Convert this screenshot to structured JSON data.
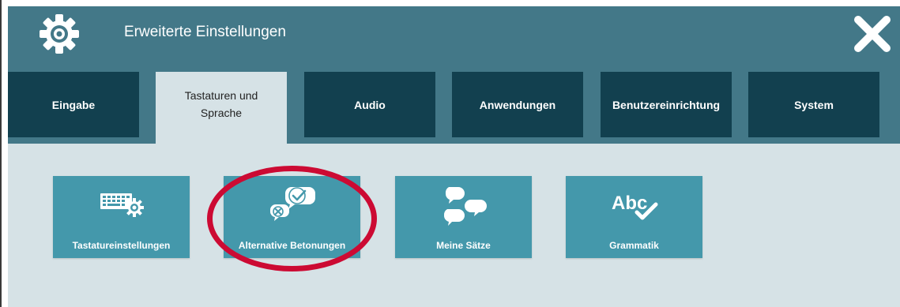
{
  "header": {
    "title": "Erweiterte Einstellungen",
    "settings_icon": "gear-icon",
    "close_icon": "close-icon"
  },
  "tabs": [
    {
      "label": "Eingabe",
      "active": false
    },
    {
      "label": "Tastaturen und Sprache",
      "active": true
    },
    {
      "label": "Audio",
      "active": false
    },
    {
      "label": "Anwendungen",
      "active": false
    },
    {
      "label": "Benutzereinrichtung",
      "active": false
    },
    {
      "label": "System",
      "active": false
    }
  ],
  "tiles": [
    {
      "label": "Tastatureinstellungen",
      "icon": "keyboard-gear-icon"
    },
    {
      "label": "Alternative Betonungen",
      "icon": "speech-bubbles-check-cross-icon"
    },
    {
      "label": "Meine Sätze",
      "icon": "speech-bubbles-icon"
    },
    {
      "label": "Grammatik",
      "icon": "abc-check-icon"
    }
  ],
  "colors": {
    "header_bg": "#437888",
    "tab_bg": "#12404f",
    "content_bg": "#d6e2e6",
    "tile_bg": "#4498ab",
    "highlight": "#cc0a33"
  }
}
